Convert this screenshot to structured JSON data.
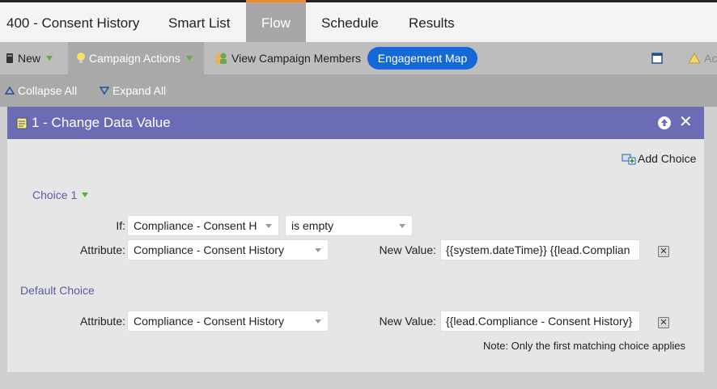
{
  "tabs": {
    "title": "400 - Consent History",
    "smart_list": "Smart List",
    "flow": "Flow",
    "schedule": "Schedule",
    "results": "Results"
  },
  "toolbar": {
    "new_label": "New",
    "campaign_actions_label": "Campaign Actions",
    "view_members_label": "View Campaign Members",
    "engagement_map_label": "Engagement Map",
    "activity_label": "Act"
  },
  "collapse_bar": {
    "collapse_all": "Collapse All",
    "expand_all": "Expand All"
  },
  "flow_step": {
    "title": "1 - Change Data Value",
    "add_choice": "Add Choice",
    "choice_label": "Choice 1",
    "if_label": "If:",
    "if_field": "Compliance - Consent H",
    "if_operator": "is empty",
    "attribute_label": "Attribute:",
    "choice_attribute": "Compliance - Consent History",
    "new_value_label": "New Value:",
    "choice_new_value": "{{system.dateTime}} {{lead.Complian",
    "default_choice_label": "Default Choice",
    "default_attribute": "Compliance - Consent History",
    "default_new_value": "{{lead.Compliance - Consent History}",
    "note": "Note: Only the first matching choice applies"
  },
  "colors": {
    "header_purple": "#6c6cb4",
    "accent_orange": "#f08a24",
    "engagement_blue": "#1569d6"
  }
}
